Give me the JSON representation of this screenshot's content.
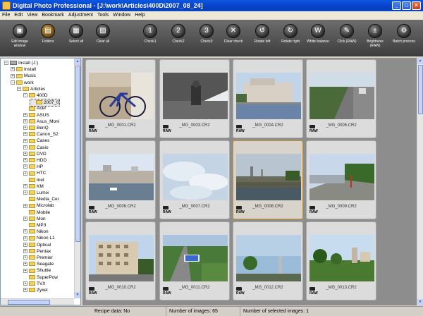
{
  "window": {
    "title": "Digital Photo Professional - [J:\\work\\Articles\\400D\\2007_08_24]",
    "buttons": {
      "minimize": "_",
      "maximize": "□",
      "close": "×"
    }
  },
  "menu": [
    "File",
    "Edit",
    "View",
    "Bookmark",
    "Adjustment",
    "Tools",
    "Window",
    "Help"
  ],
  "toolbar": [
    {
      "id": "edit-image-window",
      "label": "Edit image window",
      "glyph": "▣",
      "icon": "edit-image-window-icon"
    },
    {
      "id": "folders",
      "label": "Folders",
      "glyph": "▤",
      "icon": "folders-icon",
      "active": true
    },
    {
      "id": "select-all",
      "label": "Select all",
      "glyph": "▦",
      "icon": "select-all-icon"
    },
    {
      "id": "clear-all",
      "label": "Clear all",
      "glyph": "▧",
      "icon": "clear-all-icon"
    },
    {
      "id": "check1",
      "label": "Check1",
      "glyph": "1",
      "icon": "check1-icon"
    },
    {
      "id": "check2",
      "label": "Check2",
      "glyph": "2",
      "icon": "check2-icon"
    },
    {
      "id": "check3",
      "label": "Check3",
      "glyph": "3",
      "icon": "check3-icon"
    },
    {
      "id": "clear-check",
      "label": "Clear check",
      "glyph": "✕",
      "icon": "clear-check-icon"
    },
    {
      "id": "rotate-left",
      "label": "Rotate left",
      "glyph": "↺",
      "icon": "rotate-left-icon"
    },
    {
      "id": "rotate-right",
      "label": "Rotate right",
      "glyph": "↻",
      "icon": "rotate-right-icon"
    },
    {
      "id": "white-balance",
      "label": "White balance",
      "glyph": "W",
      "icon": "white-balance-icon"
    },
    {
      "id": "click-raw",
      "label": "Click (RAW)",
      "glyph": "✎",
      "icon": "eyedropper-icon"
    },
    {
      "id": "brightness-raw",
      "label": "Brightness (RAW)",
      "glyph": "±",
      "icon": "brightness-icon"
    },
    {
      "id": "batch-process",
      "label": "Batch process",
      "glyph": "⚙",
      "icon": "batch-process-icon"
    }
  ],
  "tree": [
    {
      "label": "Install (J:)",
      "indent": 1,
      "exp": "−",
      "kind": "drive"
    },
    {
      "label": "Install",
      "indent": 2,
      "exp": "+",
      "kind": "folder"
    },
    {
      "label": "Music",
      "indent": 2,
      "exp": "+",
      "kind": "folder"
    },
    {
      "label": "work",
      "indent": 2,
      "exp": "−",
      "kind": "folder"
    },
    {
      "label": "Articles",
      "indent": 3,
      "exp": "−",
      "kind": "folder"
    },
    {
      "label": "400D",
      "indent": 4,
      "exp": "−",
      "kind": "folder"
    },
    {
      "label": "2007_0",
      "indent": 5,
      "exp": "",
      "kind": "folder",
      "selected": true
    },
    {
      "label": "Acer",
      "indent": 4,
      "exp": "",
      "kind": "folder"
    },
    {
      "label": "ASUS",
      "indent": 4,
      "exp": "+",
      "kind": "folder"
    },
    {
      "label": "Asus_Moni",
      "indent": 4,
      "exp": "+",
      "kind": "folder"
    },
    {
      "label": "BenQ",
      "indent": 4,
      "exp": "+",
      "kind": "folder"
    },
    {
      "label": "Canon_S2",
      "indent": 4,
      "exp": "+",
      "kind": "folder"
    },
    {
      "label": "Cases",
      "indent": 4,
      "exp": "+",
      "kind": "folder"
    },
    {
      "label": "Casio",
      "indent": 4,
      "exp": "+",
      "kind": "folder"
    },
    {
      "label": "DVD",
      "indent": 4,
      "exp": "+",
      "kind": "folder"
    },
    {
      "label": "HDD",
      "indent": 4,
      "exp": "+",
      "kind": "folder"
    },
    {
      "label": "HP",
      "indent": 4,
      "exp": "+",
      "kind": "folder"
    },
    {
      "label": "HTC",
      "indent": 4,
      "exp": "+",
      "kind": "folder"
    },
    {
      "label": "Inet",
      "indent": 4,
      "exp": "",
      "kind": "folder"
    },
    {
      "label": "KM",
      "indent": 4,
      "exp": "+",
      "kind": "folder"
    },
    {
      "label": "Lumix",
      "indent": 4,
      "exp": "+",
      "kind": "folder"
    },
    {
      "label": "Media_Cer",
      "indent": 4,
      "exp": "",
      "kind": "folder"
    },
    {
      "label": "Microlab",
      "indent": 4,
      "exp": "+",
      "kind": "folder"
    },
    {
      "label": "Mobile",
      "indent": 4,
      "exp": "",
      "kind": "folder"
    },
    {
      "label": "Mon",
      "indent": 4,
      "exp": "+",
      "kind": "folder"
    },
    {
      "label": "MP3",
      "indent": 4,
      "exp": "",
      "kind": "folder"
    },
    {
      "label": "Nikon",
      "indent": 4,
      "exp": "+",
      "kind": "folder"
    },
    {
      "label": "Nikon L1",
      "indent": 4,
      "exp": "+",
      "kind": "folder"
    },
    {
      "label": "Optical",
      "indent": 4,
      "exp": "+",
      "kind": "folder"
    },
    {
      "label": "Pentax",
      "indent": 4,
      "exp": "+",
      "kind": "folder"
    },
    {
      "label": "Premier",
      "indent": 4,
      "exp": "+",
      "kind": "folder"
    },
    {
      "label": "Seagate",
      "indent": 4,
      "exp": "+",
      "kind": "folder"
    },
    {
      "label": "Shuttle",
      "indent": 4,
      "exp": "+",
      "kind": "folder"
    },
    {
      "label": "SuperPow",
      "indent": 4,
      "exp": "",
      "kind": "folder"
    },
    {
      "label": "TVX",
      "indent": 4,
      "exp": "+",
      "kind": "folder"
    },
    {
      "label": "Zyxel",
      "indent": 4,
      "exp": "+",
      "kind": "folder"
    }
  ],
  "thumbnails": [
    {
      "name": "_MG_0001.CR2",
      "scene": "bicycle",
      "raw": "RAW"
    },
    {
      "name": "_MG_0003.CR2",
      "scene": "window",
      "raw": "RAW"
    },
    {
      "name": "_MG_0004.CR2",
      "scene": "riverbuilding",
      "raw": "RAW"
    },
    {
      "name": "_MG_0005.CR2",
      "scene": "highway",
      "raw": "RAW"
    },
    {
      "name": "_MG_0006.CR2",
      "scene": "river2",
      "raw": "RAW"
    },
    {
      "name": "_MG_0007.CR2",
      "scene": "clouds",
      "raw": "RAW"
    },
    {
      "name": "_MG_0008.CR2",
      "scene": "bridge",
      "raw": "RAW",
      "selected": true
    },
    {
      "name": "_MG_0009.CR2",
      "scene": "embankment",
      "raw": "RAW"
    },
    {
      "name": "_MG_0010.CR2",
      "scene": "apartment",
      "raw": "RAW"
    },
    {
      "name": "_MG_0011.CR2",
      "scene": "street",
      "raw": "RAW"
    },
    {
      "name": "_MG_0012.CR2",
      "scene": "skyline",
      "raw": "RAW"
    },
    {
      "name": "_MG_0013.CR2",
      "scene": "park",
      "raw": "RAW"
    }
  ],
  "status": {
    "recipe": "Recipe data: No",
    "count": "Number of images: 65",
    "selected": "Number of selected images: 1"
  }
}
